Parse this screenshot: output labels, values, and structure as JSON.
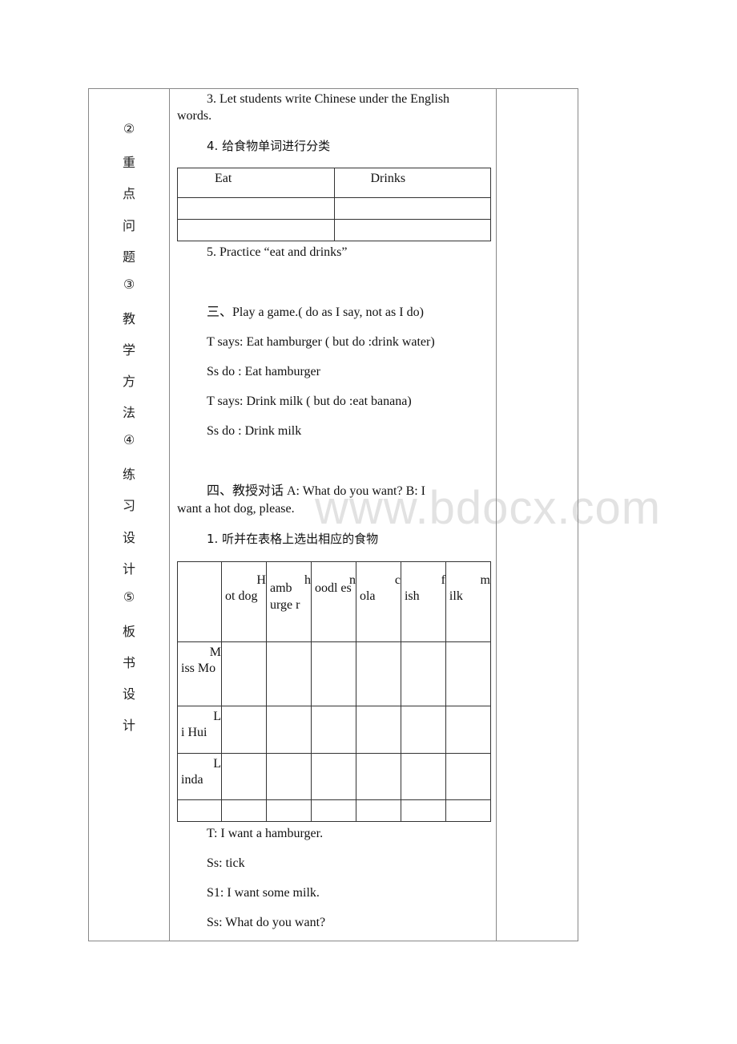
{
  "left_column": {
    "chars": [
      "②",
      "重",
      "点",
      "问",
      "题",
      "③",
      "教",
      "学",
      "方",
      "法",
      "④",
      "练",
      "习",
      "设",
      "计",
      "⑤",
      "板",
      "书",
      "设",
      "计"
    ]
  },
  "content": {
    "item3_line1": "3. Let students write Chinese under the English",
    "item3_line2": "words.",
    "item4": "4. 给食物单词进行分类",
    "classify_table": {
      "headers": [
        "Eat",
        "Drinks"
      ],
      "rows": [
        [
          "",
          ""
        ],
        [
          "",
          ""
        ]
      ]
    },
    "item5": "5. Practice “eat and drinks”",
    "game_title": "三、Play a game.( do as I say, not as I do)",
    "game_lines": [
      "T says: Eat hamburger ( but do :drink water)",
      "Ss do : Eat hamburger",
      "T says: Drink milk ( but do :eat banana)",
      "Ss do : Drink milk"
    ],
    "dialog_line1": "四、教授对话 A: What do you want? B: I",
    "dialog_line2": "want a hot dog, please.",
    "listen_title": "1. 听并在表格上选出相应的食物",
    "food_table": {
      "headers": [
        {
          "first": "",
          "rest": ""
        },
        {
          "first": "H",
          "rest": "ot dog"
        },
        {
          "first": "h",
          "rest": "amb urge r"
        },
        {
          "first": "n",
          "rest": "oodl es"
        },
        {
          "first": "c",
          "rest": "ola"
        },
        {
          "first": "f",
          "rest": "ish"
        },
        {
          "first": "m",
          "rest": "ilk"
        }
      ],
      "rows": [
        {
          "first": "M",
          "rest": "iss Mo"
        },
        {
          "first": "L",
          "rest": "i Hui"
        },
        {
          "first": "L",
          "rest": "inda"
        },
        {
          "first": "",
          "rest": ""
        }
      ]
    },
    "closing_lines": [
      "T: I want a hamburger.",
      "Ss: tick",
      "S1: I want some milk.",
      "Ss: What do you want?"
    ]
  },
  "watermark": "www.bdocx.com"
}
